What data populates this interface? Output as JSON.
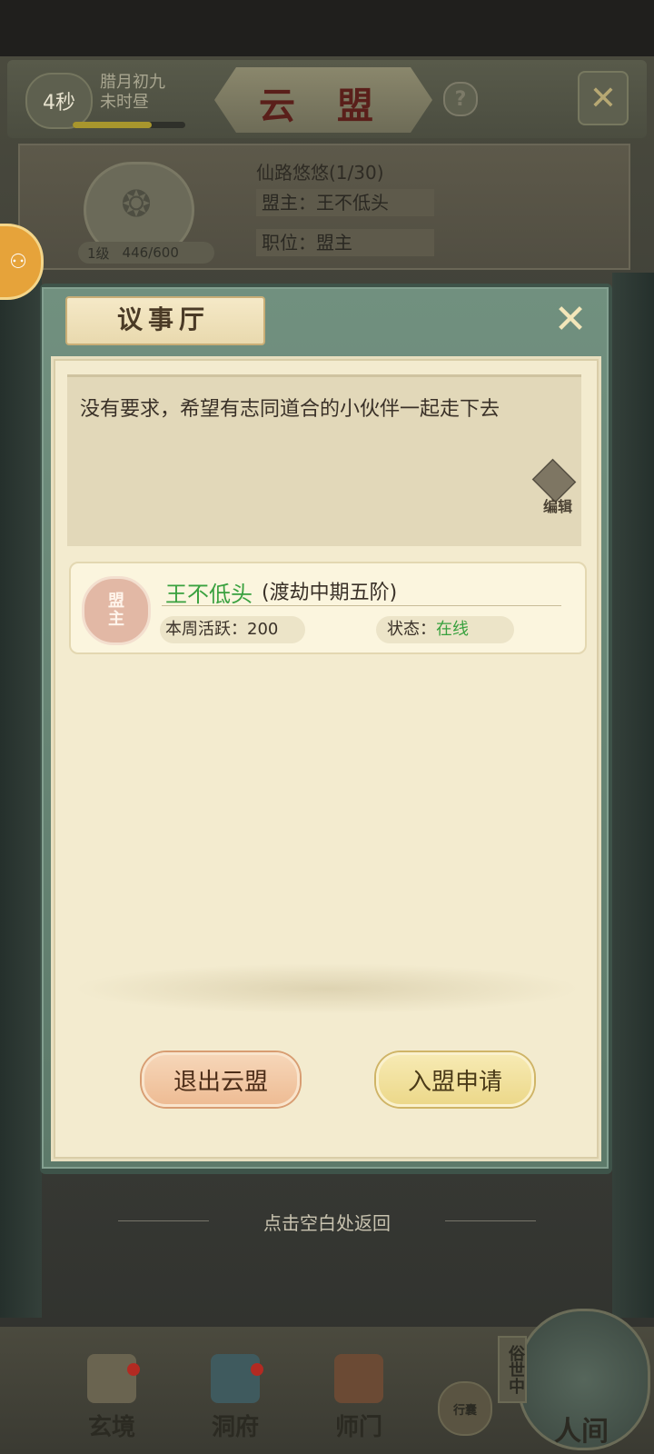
{
  "header": {
    "countdown": "4秒",
    "calendar_date": "腊月初九",
    "calendar_time": "未时昼",
    "day_progress": 0.7,
    "title": "云 盟",
    "help_symbol": "?",
    "close_symbol": "✕"
  },
  "guild": {
    "name": "仙路悠悠(1/30)",
    "leader": "盟主：王不低头",
    "position": "职位：盟主",
    "level": "1级",
    "exp": "446/600"
  },
  "modal": {
    "title": "议事厅",
    "close_symbol": "✕",
    "notice": "没有要求，希望有志同道合的小伙伴一起走下去",
    "edit_label": "编辑",
    "members": [
      {
        "role_line1": "盟",
        "role_line2": "主",
        "name": "王不低头",
        "realm": "(渡劫中期五阶)",
        "activity": "本周活跃：200",
        "status_label": "状态：",
        "status_value": "在线"
      }
    ],
    "leave_button": "退出云盟",
    "apply_button": "入盟申请",
    "return_hint": "点击空白处返回"
  },
  "nav": {
    "items": [
      {
        "label": "玄境",
        "badge": true
      },
      {
        "label": "洞府",
        "badge": true
      },
      {
        "label": "师门",
        "badge": false
      }
    ],
    "pack_label": "行囊",
    "vertical_tag": "俗世中",
    "main_label": "人间"
  },
  "colors": {
    "online_green": "#39a13f",
    "modal_frame": "#71907f",
    "paper": "#f3ebcf"
  }
}
